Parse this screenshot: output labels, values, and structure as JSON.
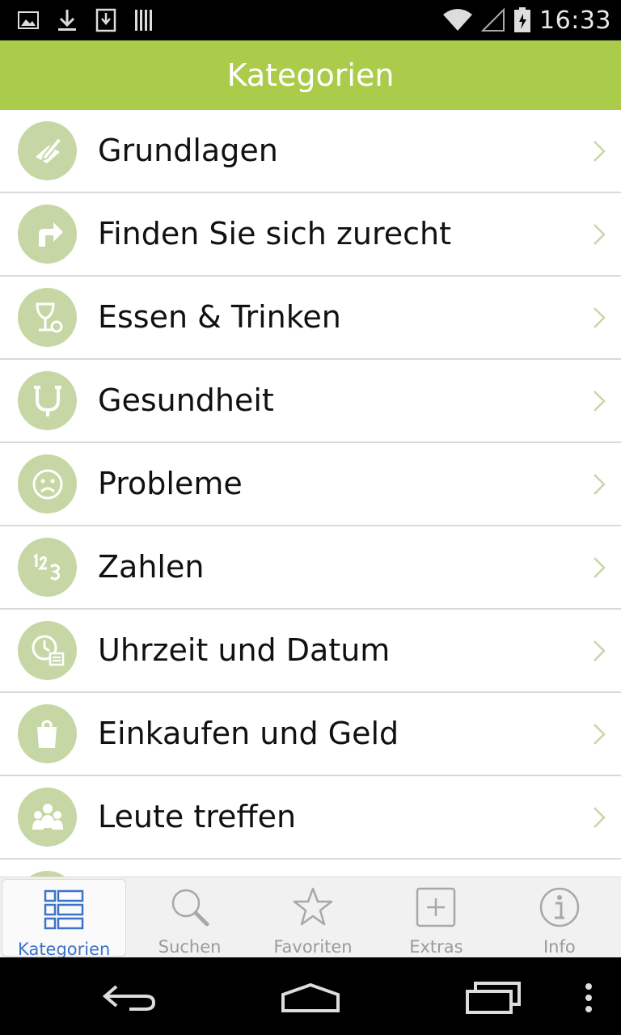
{
  "status_bar": {
    "time": "16:33",
    "left_icons": [
      "image-icon",
      "download-icon",
      "save-icon",
      "barcode-icon"
    ],
    "right_icons": [
      "wifi-icon",
      "signal-icon",
      "battery-icon"
    ]
  },
  "header": {
    "title": "Kategorien"
  },
  "colors": {
    "accent": "#abcc4a",
    "icon_bg": "#c6d7a5",
    "active_tab": "#3b73c8"
  },
  "categories": [
    {
      "label": "Grundlagen",
      "icon": "pencil-paper-icon"
    },
    {
      "label": "Finden Sie sich zurecht",
      "icon": "turn-right-arrow-icon"
    },
    {
      "label": "Essen & Trinken",
      "icon": "wine-glass-icon"
    },
    {
      "label": "Gesundheit",
      "icon": "stethoscope-icon"
    },
    {
      "label": "Probleme",
      "icon": "sad-face-icon"
    },
    {
      "label": "Zahlen",
      "icon": "numbers-icon"
    },
    {
      "label": "Uhrzeit und Datum",
      "icon": "clock-calendar-icon"
    },
    {
      "label": "Einkaufen und Geld",
      "icon": "shopping-bag-icon"
    },
    {
      "label": "Leute treffen",
      "icon": "people-icon"
    }
  ],
  "tabs": [
    {
      "label": "Kategorien",
      "icon": "grid-list-icon",
      "active": true
    },
    {
      "label": "Suchen",
      "icon": "magnifier-icon",
      "active": false
    },
    {
      "label": "Favoriten",
      "icon": "star-icon",
      "active": false
    },
    {
      "label": "Extras",
      "icon": "plus-box-icon",
      "active": false
    },
    {
      "label": "Info",
      "icon": "info-icon",
      "active": false
    }
  ],
  "nav_bar": [
    "back-icon",
    "home-icon",
    "recents-icon",
    "overflow-icon"
  ]
}
